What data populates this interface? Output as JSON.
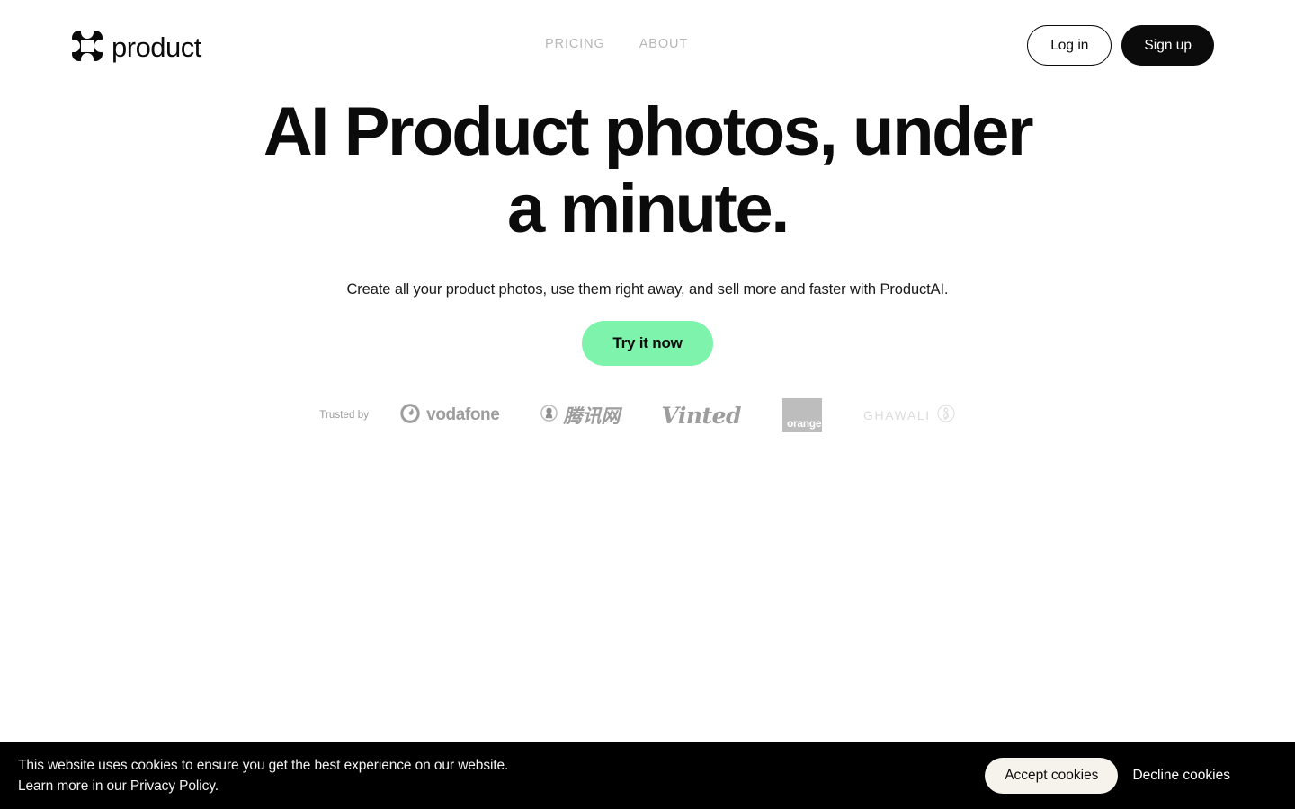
{
  "header": {
    "logo": {
      "mark_icon": "clover-logo-icon",
      "text": "product"
    },
    "nav": [
      {
        "label": "PRICING"
      },
      {
        "label": "ABOUT"
      }
    ],
    "auth": {
      "login_label": "Log in",
      "signup_label": "Sign up"
    }
  },
  "hero": {
    "title": "AI Product photos, under a minute.",
    "subtitle": "Create all your product photos, use them right away, and sell more and faster with ProductAI.",
    "cta_label": "Try it now",
    "cta_color": "#7df3ab"
  },
  "trusted": {
    "label": "Trusted by",
    "logos": [
      {
        "name": "vodafone",
        "text": "vodafone",
        "icon": "vodafone-circle-icon"
      },
      {
        "name": "tencent",
        "text": "腾讯网",
        "icon": "tencent-penguin-icon"
      },
      {
        "name": "vinted",
        "text": "Vinted",
        "icon": ""
      },
      {
        "name": "orange",
        "text": "orange",
        "icon": ""
      },
      {
        "name": "ghawali",
        "text": "GHAWALI",
        "icon": "ghawali-monogram-icon"
      }
    ]
  },
  "cookie": {
    "line1": "This website uses cookies to ensure you get the best experience on our website.",
    "line2": "Learn more in our Privacy Policy.",
    "accept_label": "Accept cookies",
    "decline_label": "Decline cookies"
  }
}
